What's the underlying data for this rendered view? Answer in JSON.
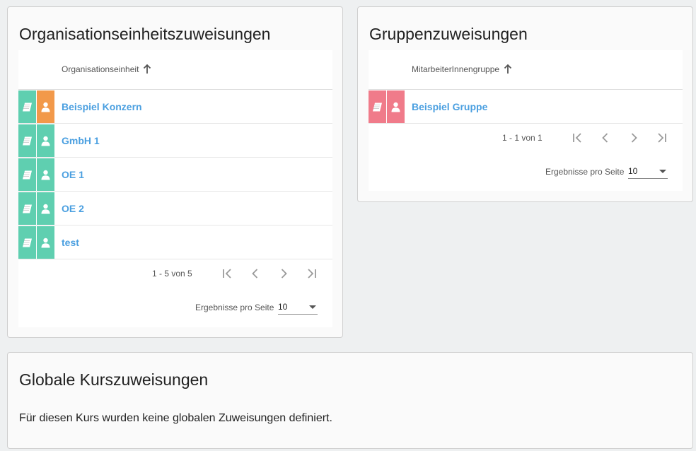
{
  "org_units": {
    "title": "Organisationseinheitszuweisungen",
    "column_header": "Organisationseinheit",
    "rows": [
      {
        "label": "Beispiel Konzern",
        "second_tile": "orange"
      },
      {
        "label": "GmbH 1",
        "second_tile": "green"
      },
      {
        "label": "OE 1",
        "second_tile": "green"
      },
      {
        "label": "OE 2",
        "second_tile": "green"
      },
      {
        "label": "test",
        "second_tile": "green"
      }
    ],
    "range_label": "1 - 5 von 5",
    "per_page_label": "Ergebnisse pro Seite",
    "per_page_value": "10"
  },
  "groups": {
    "title": "Gruppenzuweisungen",
    "column_header": "MitarbeiterInnengruppe",
    "rows": [
      {
        "label": "Beispiel Gruppe",
        "second_tile": "pink"
      }
    ],
    "range_label": "1 - 1 von 1",
    "per_page_label": "Ergebnisse pro Seite",
    "per_page_value": "10"
  },
  "global": {
    "title": "Globale Kurszuweisungen",
    "message": "Für diesen Kurs wurden keine globalen Zuweisungen definiert."
  },
  "colors": {
    "tile_green": "#5fcfb0",
    "tile_orange": "#f2994a",
    "tile_pink": "#f07b8a",
    "link": "#4a9fe0"
  },
  "icons": {
    "course": "book-icon",
    "person": "person-icon",
    "sort": "arrow-up-icon",
    "first": "first-page-icon",
    "prev": "chevron-left-icon",
    "next": "chevron-right-icon",
    "last": "last-page-icon",
    "dropdown": "caret-down-icon"
  }
}
